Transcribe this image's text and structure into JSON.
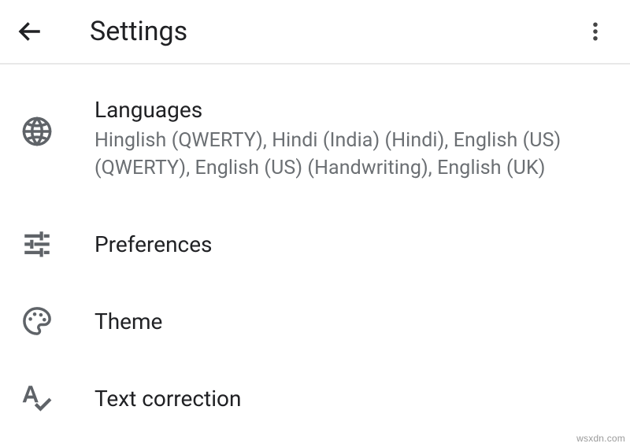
{
  "appbar": {
    "title": "Settings"
  },
  "items": {
    "languages": {
      "title": "Languages",
      "subtitle": "Hinglish (QWERTY), Hindi (India) (Hindi), English (US) (QWERTY), English (US) (Handwriting), English (UK)"
    },
    "preferences": {
      "title": "Preferences"
    },
    "theme": {
      "title": "Theme"
    },
    "textcorrection": {
      "title": "Text correction"
    }
  },
  "watermark": "wsxdn.com"
}
